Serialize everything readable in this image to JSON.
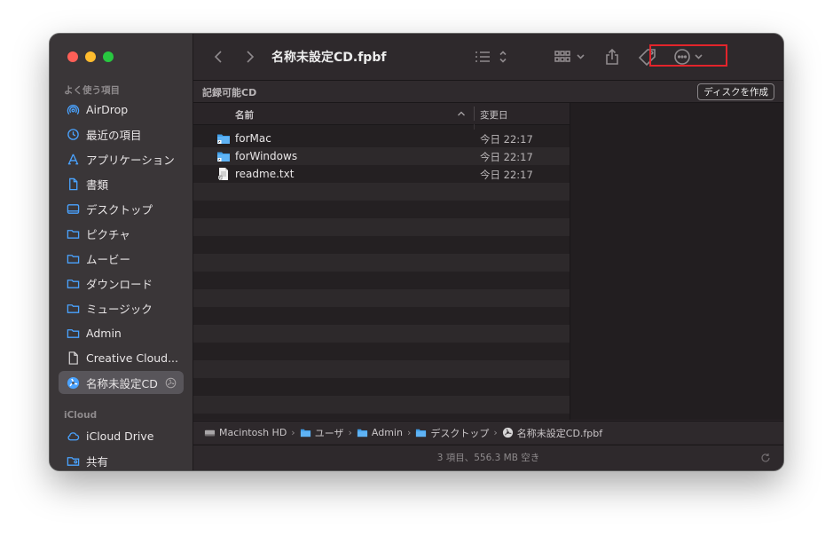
{
  "window": {
    "title": "名称未設定CD.fpbf"
  },
  "sidebar": {
    "favorites_heading": "よく使う項目",
    "items": [
      {
        "label": "AirDrop",
        "icon": "airdrop-icon"
      },
      {
        "label": "最近の項目",
        "icon": "clock-icon"
      },
      {
        "label": "アプリケーション",
        "icon": "applications-icon"
      },
      {
        "label": "書類",
        "icon": "document-icon"
      },
      {
        "label": "デスクトップ",
        "icon": "desktop-icon"
      },
      {
        "label": "ピクチャ",
        "icon": "folder-icon"
      },
      {
        "label": "ムービー",
        "icon": "folder-icon"
      },
      {
        "label": "ダウンロード",
        "icon": "folder-icon"
      },
      {
        "label": "ミュージック",
        "icon": "folder-icon"
      },
      {
        "label": "Admin",
        "icon": "folder-icon"
      },
      {
        "label": "Creative Cloud...",
        "icon": "file-icon"
      },
      {
        "label": "名称未設定CD",
        "icon": "burn-disc-icon"
      }
    ],
    "icloud_heading": "iCloud",
    "icloud_items": [
      {
        "label": "iCloud Drive",
        "icon": "cloud-icon"
      },
      {
        "label": "共有",
        "icon": "shared-folder-icon"
      }
    ]
  },
  "burnbar": {
    "label": "記録可能CD",
    "button": "ディスクを作成"
  },
  "columns": {
    "name": "名前",
    "date": "変更日"
  },
  "files": [
    {
      "name": "forMac",
      "date": "今日 22:17",
      "icon": "folder-icon"
    },
    {
      "name": "forWindows",
      "date": "今日 22:17",
      "icon": "folder-icon"
    },
    {
      "name": "readme.txt",
      "date": "今日 22:17",
      "icon": "text-file-icon"
    }
  ],
  "pathbar": [
    {
      "label": "Macintosh HD",
      "icon": "hard-drive-icon"
    },
    {
      "label": "ユーザ",
      "icon": "folder-icon"
    },
    {
      "label": "Admin",
      "icon": "folder-icon"
    },
    {
      "label": "デスクトップ",
      "icon": "folder-icon"
    },
    {
      "label": "名称未設定CD.fpbf",
      "icon": "disc-icon"
    }
  ],
  "status": "3 項目、556.3 MB 空き",
  "colors": {
    "accent_highlight": "#e3242b",
    "folder_blue": "#3f9ee8"
  }
}
